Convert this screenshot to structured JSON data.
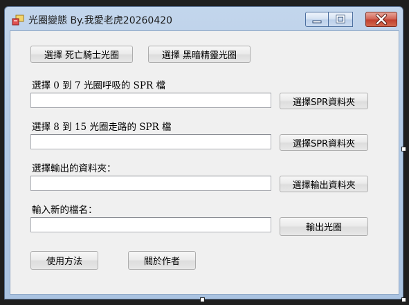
{
  "window": {
    "title": "光圈變態 By.我愛老虎20260420"
  },
  "buttons": {
    "death_knight": "選擇 死亡騎士光圈",
    "dark_elf": "選擇 黑暗精靈光圈",
    "spr_folder_1": "選擇SPR資料夾",
    "spr_folder_2": "選擇SPR資料夾",
    "output_folder": "選擇輸出資料夾",
    "export": "輸出光圈",
    "usage": "使用方法",
    "about": "關於作者"
  },
  "labels": {
    "breath": {
      "prefix": "選擇 ",
      "serif": "0 到 7",
      "middle": " 光圈呼吸的 ",
      "serif2": "SPR",
      "suffix": " 檔"
    },
    "walk": {
      "prefix": "選擇 ",
      "serif": "8 到 15",
      "middle": " 光圈走路的 ",
      "serif2": "SPR",
      "suffix": " 檔"
    },
    "output": "選擇輸出的資料夾：",
    "filename": "輸入新的檔名："
  },
  "inputs": {
    "breath_path": "",
    "walk_path": "",
    "output_path": "",
    "new_filename": ""
  },
  "icons": {
    "app": "app-window-icon",
    "minimize": "minimize-icon",
    "maximize": "maximize-icon",
    "close": "close-icon"
  }
}
